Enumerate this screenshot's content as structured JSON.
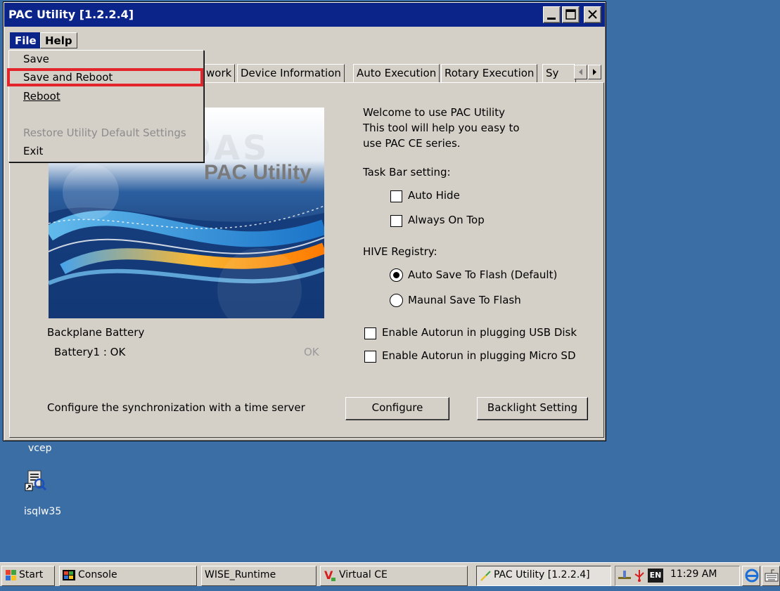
{
  "window": {
    "title": "PAC Utility  [1.2.2.4]"
  },
  "menubar": {
    "file": "File",
    "help": "Help"
  },
  "file_menu": {
    "items": [
      "Save",
      "Save and Reboot",
      "Reboot",
      "Restore Utility Default Settings",
      "Exit"
    ],
    "highlighted": "Save and Reboot"
  },
  "tabs": [
    "work",
    "Device Information",
    "Auto Execution",
    "Rotary Execution",
    "Sy"
  ],
  "banner": {
    "logo_text": "PAC Utility",
    "watermark": "ICP DAS"
  },
  "welcome": {
    "line1": "Welcome to use PAC Utility",
    "line2": "This tool will help you easy to",
    "line3": "use PAC CE series."
  },
  "taskbar_setting": {
    "heading": "Task Bar setting:",
    "auto_hide": "Auto Hide",
    "always_on_top": "Always On Top"
  },
  "hive": {
    "heading": "HIVE Registry:",
    "auto_save": "Auto Save To Flash (Default)",
    "manual_save": "Maunal Save To Flash"
  },
  "autorun": {
    "usb": "Enable Autorun in plugging USB Disk",
    "sd": "Enable Autorun in plugging Micro SD"
  },
  "battery": {
    "heading": "Backplane Battery",
    "label": "Battery1 : OK",
    "status": "OK"
  },
  "time_sync": {
    "text": "Configure the synchronization with a time server",
    "configure_label": "Configure",
    "backlight_label": "Backlight Setting"
  },
  "desktop": {
    "icons": [
      "vcep",
      "isqlw35"
    ]
  },
  "taskbar": {
    "start": "Start",
    "buttons": [
      "Console",
      "WISE_Runtime",
      "Virtual CE",
      "PAC Utility  [1.2.2.4]"
    ],
    "lang": "EN",
    "clock": "11:29 AM"
  },
  "colors": {
    "desktop": "#3a6ea5",
    "titlebar": "#0b2489",
    "face": "#d4d0c8",
    "highlight_box": "#e3242b"
  }
}
